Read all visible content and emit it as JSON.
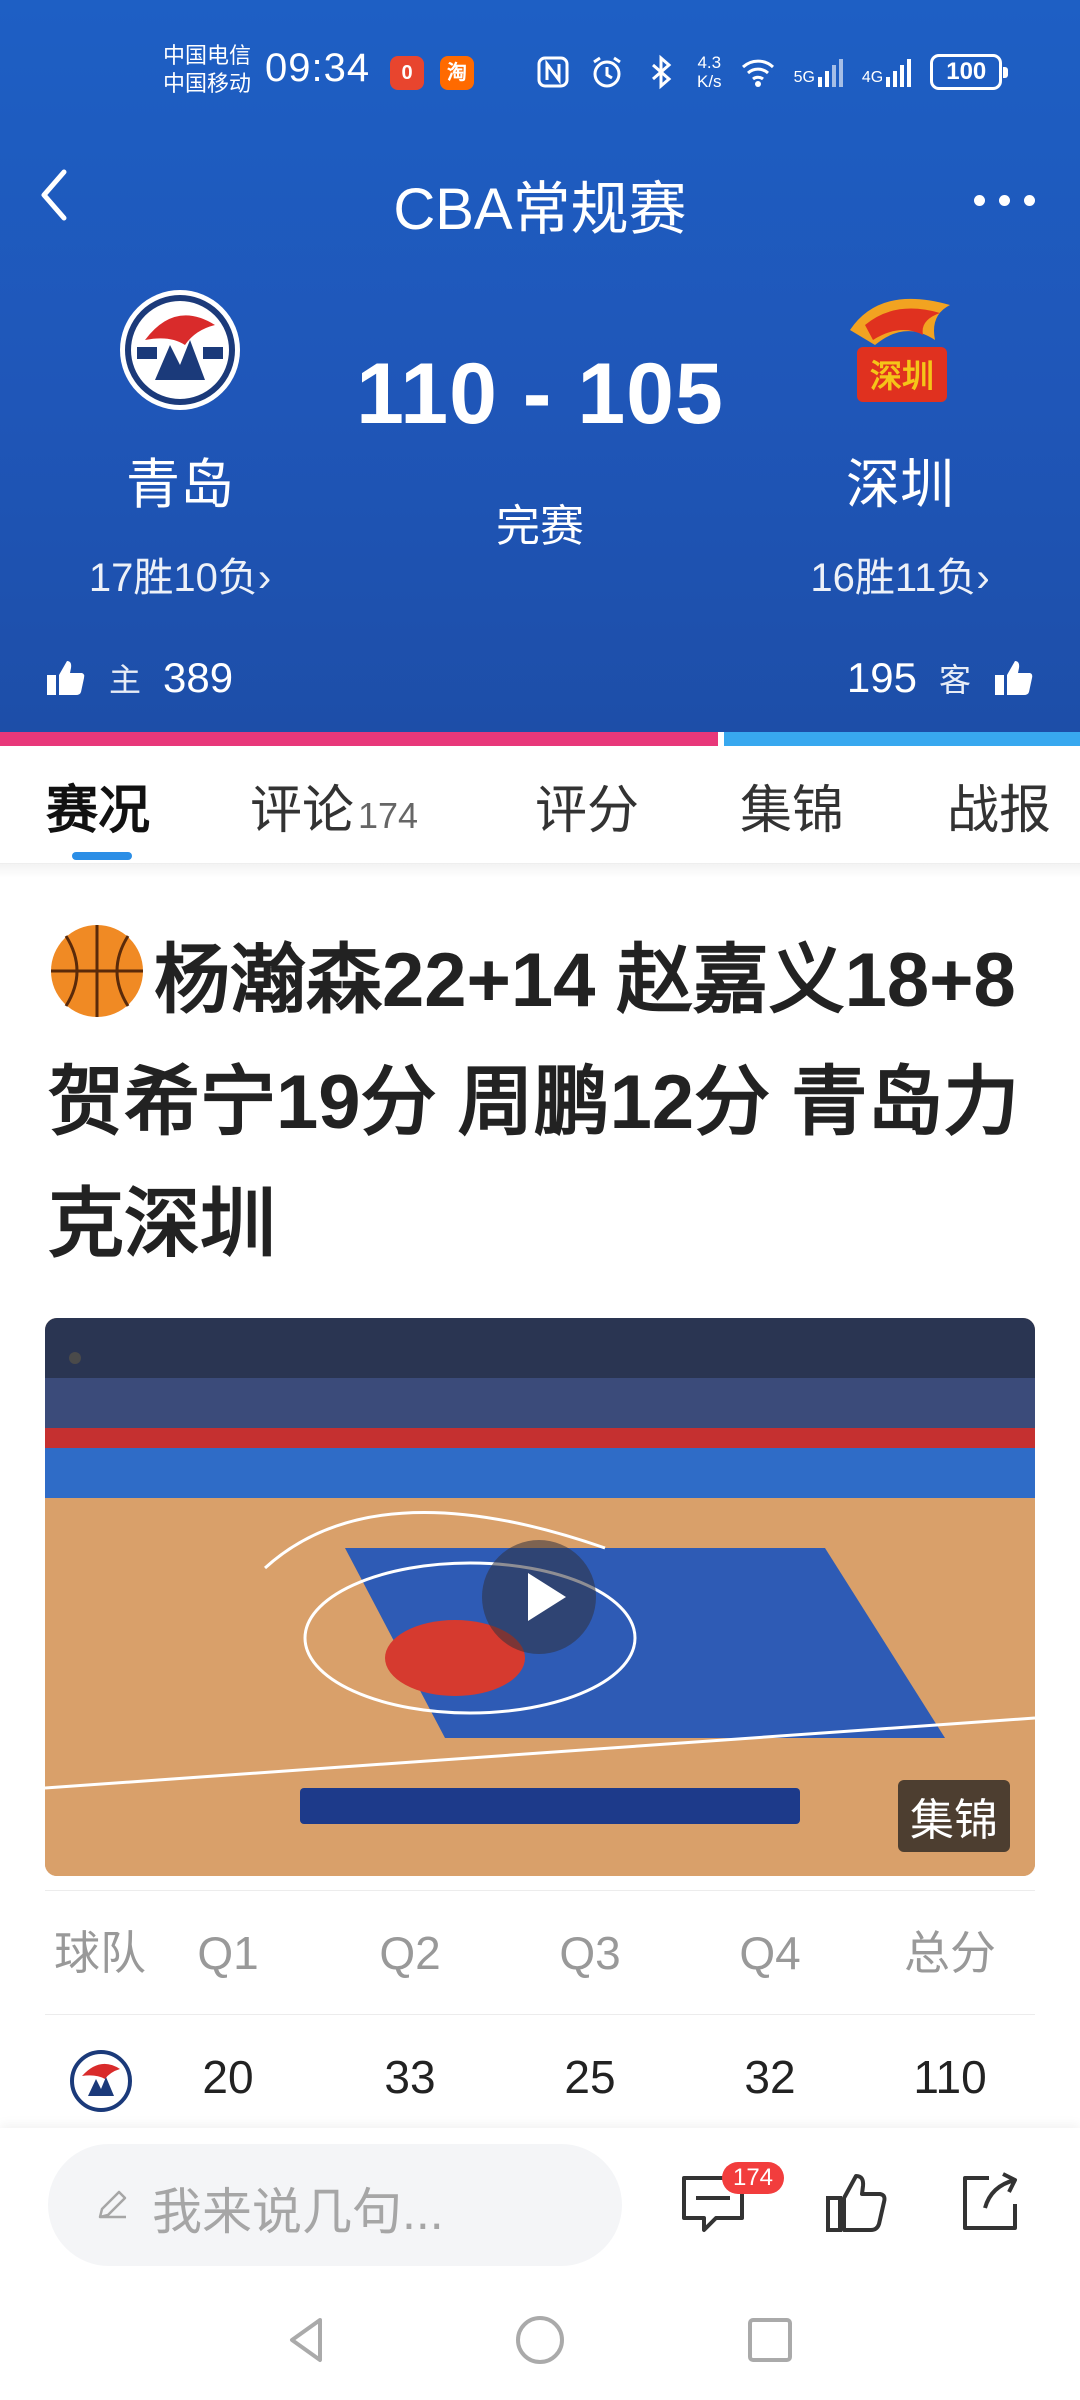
{
  "status_bar": {
    "carrier_1": "中国电信",
    "carrier_2": "中国移动",
    "time": "09:34",
    "app_badge_1": "0",
    "app_badge_2": "淘",
    "net_speed_value": "4.3",
    "net_speed_unit": "K/s",
    "signal_1": "5G",
    "signal_2": "4G",
    "battery": "100"
  },
  "nav": {
    "title": "CBA常规赛"
  },
  "match": {
    "home": {
      "name": "青岛",
      "record": "17胜10负›",
      "likes": "389",
      "likes_tag": "主"
    },
    "away": {
      "name": "深圳",
      "record": "16胜11负›",
      "likes": "195",
      "likes_tag": "客"
    },
    "score": "110 - 105",
    "status": "完赛",
    "home_vote_share": 0.665
  },
  "tabs": [
    {
      "label": "赛况",
      "count": ""
    },
    {
      "label": "评论",
      "count": "174"
    },
    {
      "label": "评分",
      "count": ""
    },
    {
      "label": "集锦",
      "count": ""
    },
    {
      "label": "战报",
      "count": ""
    }
  ],
  "article": {
    "headline": "杨瀚森22+14 赵嘉义18+8 贺希宁19分 周鹏12分 青岛力克深圳",
    "video_tag": "集锦"
  },
  "score_table": {
    "headers": [
      "球队",
      "Q1",
      "Q2",
      "Q3",
      "Q4",
      "总分"
    ],
    "rows": [
      {
        "team_icon": "qingdao-logo",
        "q1": "20",
        "q2": "33",
        "q3": "25",
        "q4": "32",
        "total": "110"
      }
    ]
  },
  "bottom_bar": {
    "placeholder": "我来说几句...",
    "comment_count": "174"
  },
  "colors": {
    "header_blue": "#1f56b8",
    "home_vote": "#e8387a",
    "away_vote": "#38a8ef",
    "tab_accent": "#2b8ee6",
    "badge_red": "#f23d3d"
  }
}
